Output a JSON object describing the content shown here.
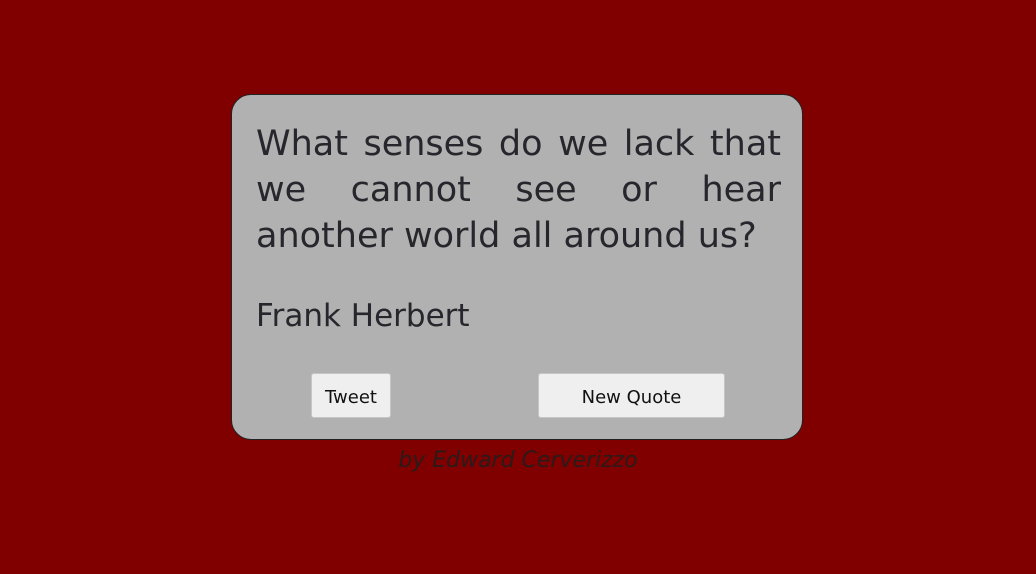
{
  "quote": {
    "text": "What senses do we lack that we cannot see or hear another world all around us?",
    "author": "Frank Herbert"
  },
  "buttons": {
    "tweet_label": "Tweet",
    "new_quote_label": "New Quote"
  },
  "footer": {
    "credit": "by Edward Cerverizzo"
  },
  "colors": {
    "page_background": "#800000",
    "card_background": "#b1b1b1",
    "text": "#26262c",
    "button_background": "#efefef"
  }
}
